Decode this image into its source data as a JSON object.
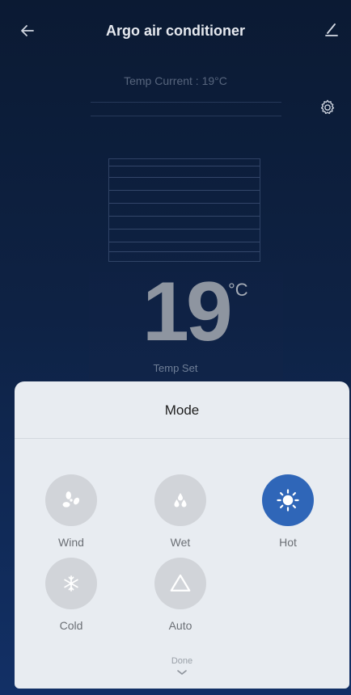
{
  "header": {
    "title": "Argo air conditioner"
  },
  "status": {
    "temp_current": "Temp Current : 19°C"
  },
  "setpoint": {
    "value": "19",
    "unit": "°C",
    "label": "Temp Set"
  },
  "mode_sheet": {
    "title": "Mode",
    "selected": "Hot",
    "modes": [
      {
        "label": "Wind",
        "icon": "fan-icon"
      },
      {
        "label": "Wet",
        "icon": "droplets-icon"
      },
      {
        "label": "Hot",
        "icon": "sun-icon"
      },
      {
        "label": "Cold",
        "icon": "snowflake-icon"
      },
      {
        "label": "Auto",
        "icon": "triangle-icon"
      }
    ],
    "done_label": "Done"
  },
  "colors": {
    "active_mode": "#2f66b8",
    "inactive_mode": "#d1d4d9",
    "sheet_bg": "#e8ecf1"
  }
}
